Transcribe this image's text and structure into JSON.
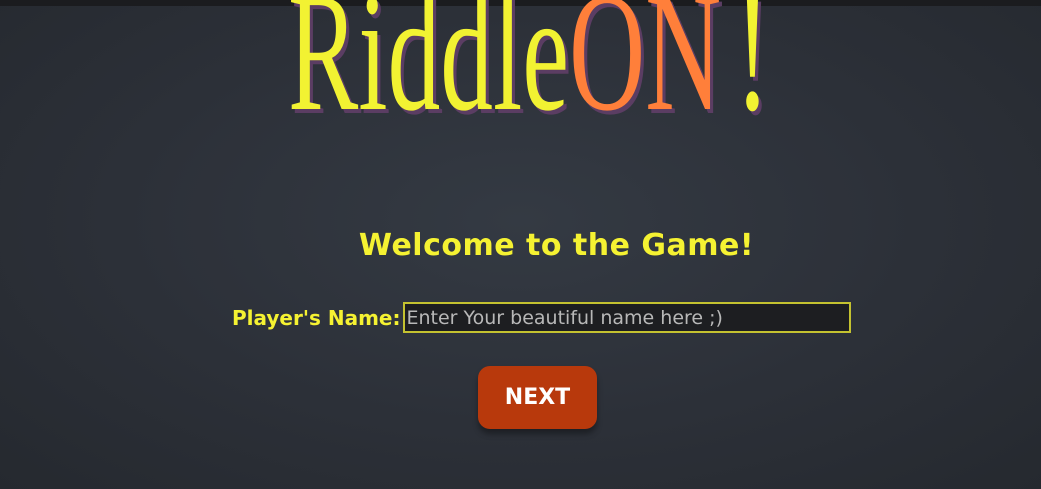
{
  "logo": {
    "part1": "Riddle",
    "part2": "ON",
    "part3": "!",
    "colors": {
      "riddle": "#f2f232",
      "on": "#ff7f3a",
      "shadow": "#5b3d63"
    }
  },
  "welcome": {
    "heading": "Welcome to the Game!"
  },
  "form": {
    "name_label": "Player's Name:",
    "name_placeholder": "Enter Your beautiful name here ;)",
    "name_value": ""
  },
  "actions": {
    "next_label": "NEXT"
  },
  "theme": {
    "accent_yellow": "#f5f232",
    "button_color": "#b8390c",
    "background": "#2c3038"
  }
}
